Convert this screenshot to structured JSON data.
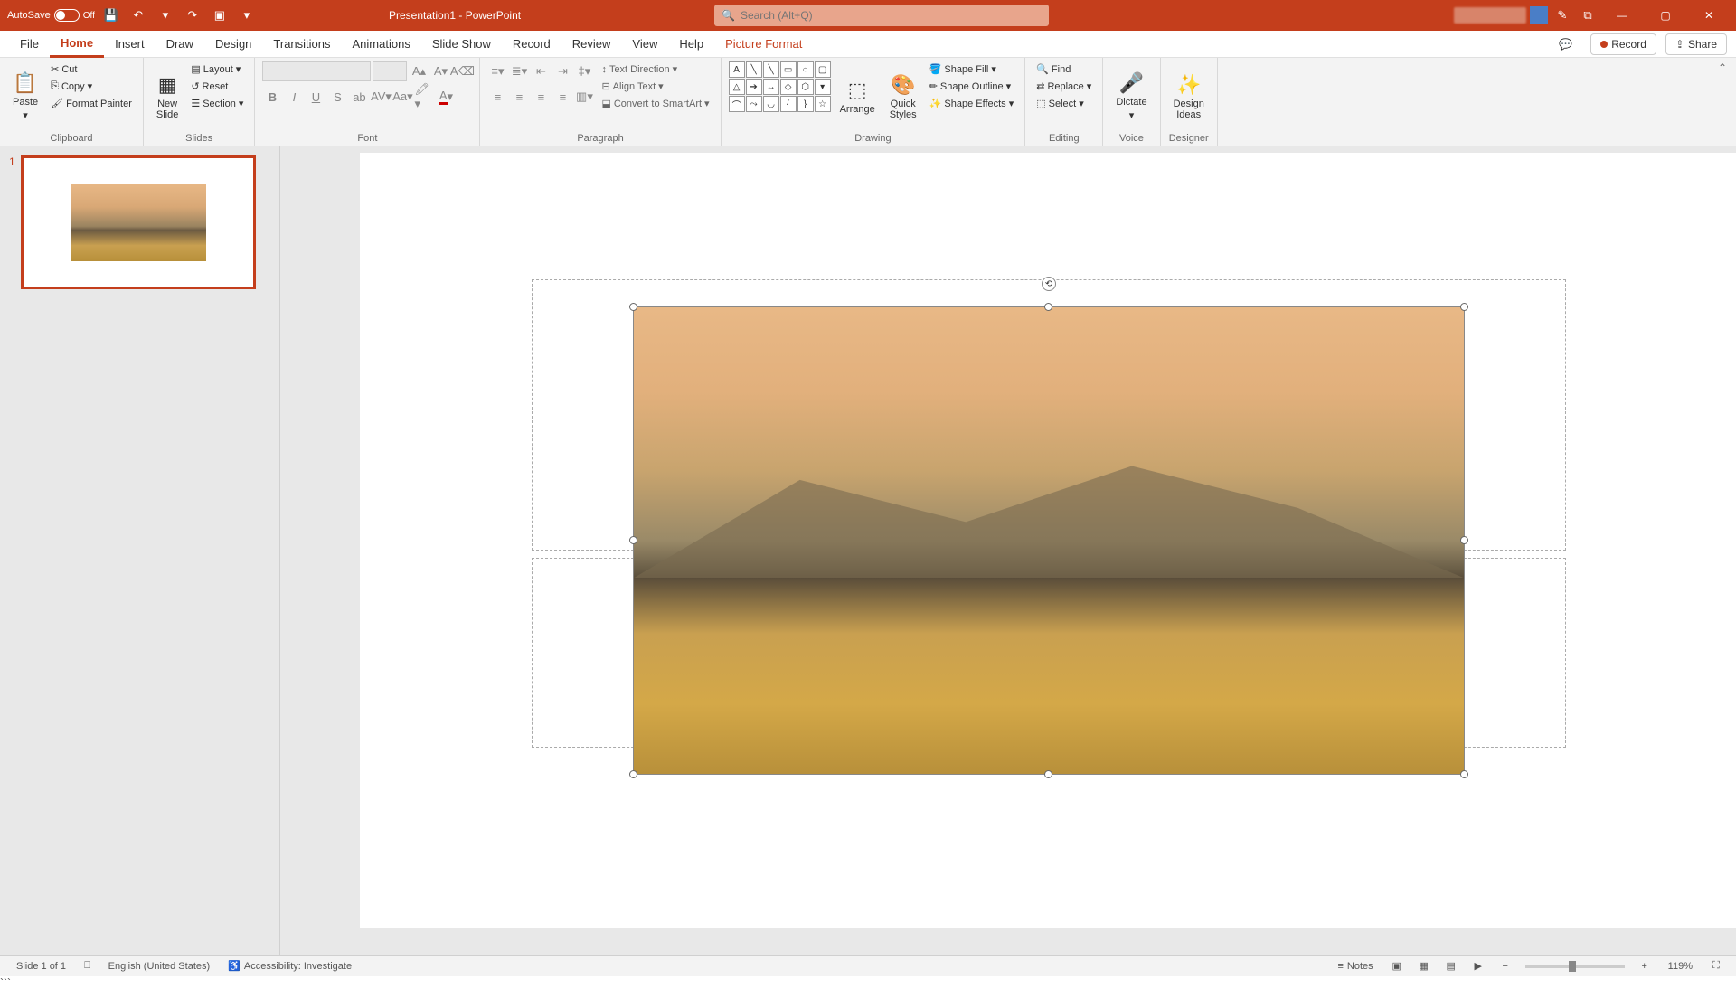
{
  "titlebar": {
    "autosave_label": "AutoSave",
    "autosave_state": "Off",
    "doc_title": "Presentation1  -  PowerPoint",
    "search_placeholder": "Search (Alt+Q)"
  },
  "tabs": {
    "file": "File",
    "home": "Home",
    "insert": "Insert",
    "draw": "Draw",
    "design": "Design",
    "transitions": "Transitions",
    "animations": "Animations",
    "slideshow": "Slide Show",
    "record": "Record",
    "review": "Review",
    "view": "View",
    "help": "Help",
    "picture_format": "Picture Format",
    "record_btn": "Record",
    "share_btn": "Share"
  },
  "ribbon": {
    "clipboard": {
      "paste": "Paste",
      "cut": "Cut",
      "copy": "Copy",
      "format_painter": "Format Painter",
      "label": "Clipboard"
    },
    "slides": {
      "new_slide": "New\nSlide",
      "layout": "Layout",
      "reset": "Reset",
      "section": "Section",
      "label": "Slides"
    },
    "font": {
      "label": "Font"
    },
    "paragraph": {
      "text_direction": "Text Direction",
      "align_text": "Align Text",
      "convert_smartart": "Convert to SmartArt",
      "label": "Paragraph"
    },
    "drawing": {
      "arrange": "Arrange",
      "quick_styles": "Quick\nStyles",
      "shape_fill": "Shape Fill",
      "shape_outline": "Shape Outline",
      "shape_effects": "Shape Effects",
      "label": "Drawing"
    },
    "editing": {
      "find": "Find",
      "replace": "Replace",
      "select": "Select",
      "label": "Editing"
    },
    "voice": {
      "dictate": "Dictate",
      "label": "Voice"
    },
    "designer": {
      "design_ideas": "Design\nIdeas",
      "label": "Designer"
    }
  },
  "thumbnails": [
    {
      "number": "1"
    }
  ],
  "statusbar": {
    "slide_info": "Slide 1 of 1",
    "language": "English (United States)",
    "accessibility": "Accessibility: Investigate",
    "notes": "Notes",
    "zoom": "119%"
  }
}
